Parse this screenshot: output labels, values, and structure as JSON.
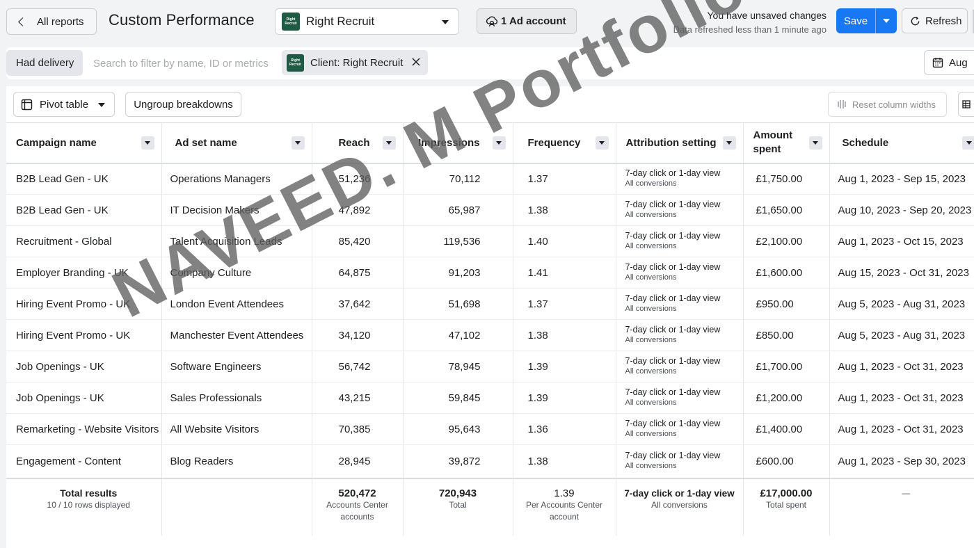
{
  "header": {
    "back_label": "All reports",
    "title": "Custom Performance",
    "client_select_value": "Right Recruit",
    "client_logo_text": "Right Recruit",
    "ad_account_label": "1 Ad account",
    "unsaved_text": "You have unsaved changes",
    "refreshed_text": "Data refreshed less than 1 minute ago",
    "save_label": "Save",
    "refresh_label": "Refresh"
  },
  "filters": {
    "had_delivery_label": "Had delivery",
    "search_placeholder": "Search to filter by name, ID or metrics",
    "client_chip_label": "Client: Right Recruit",
    "date_label": "Aug"
  },
  "toolbar": {
    "pivot_label": "Pivot table",
    "ungroup_label": "Ungroup breakdowns",
    "reset_label": "Reset column widths"
  },
  "columns": {
    "campaign": "Campaign name",
    "adset": "Ad set name",
    "reach": "Reach",
    "impressions": "Impressions",
    "frequency": "Frequency",
    "attribution": "Attribution setting",
    "amount": "Amount spent",
    "schedule": "Schedule"
  },
  "rows": [
    {
      "campaign": "B2B Lead Gen - UK",
      "adset": "Operations Managers",
      "reach": "51,236",
      "impressions": "70,112",
      "frequency": "1.37",
      "attr1": "7-day click or 1-day view",
      "attr2": "All conversions",
      "amount": "£1,750.00",
      "schedule": "Aug 1, 2023 - Sep 15, 2023"
    },
    {
      "campaign": "B2B Lead Gen - UK",
      "adset": "IT Decision Makers",
      "reach": "47,892",
      "impressions": "65,987",
      "frequency": "1.38",
      "attr1": "7-day click or 1-day view",
      "attr2": "All conversions",
      "amount": "£1,650.00",
      "schedule": "Aug 10, 2023 - Sep 20, 2023"
    },
    {
      "campaign": "Recruitment - Global",
      "adset": "Talent Acquisition Leads",
      "reach": "85,420",
      "impressions": "119,536",
      "frequency": "1.40",
      "attr1": "7-day click or 1-day view",
      "attr2": "All conversions",
      "amount": "£2,100.00",
      "schedule": "Aug 1, 2023 - Oct 15, 2023"
    },
    {
      "campaign": "Employer Branding - UK",
      "adset": "Company Culture",
      "reach": "64,875",
      "impressions": "91,203",
      "frequency": "1.41",
      "attr1": "7-day click or 1-day view",
      "attr2": "All conversions",
      "amount": "£1,600.00",
      "schedule": "Aug 15, 2023 - Oct 31, 2023"
    },
    {
      "campaign": "Hiring Event Promo - UK",
      "adset": "London Event Attendees",
      "reach": "37,642",
      "impressions": "51,698",
      "frequency": "1.37",
      "attr1": "7-day click or 1-day view",
      "attr2": "All conversions",
      "amount": "£950.00",
      "schedule": "Aug 5, 2023 - Aug 31, 2023"
    },
    {
      "campaign": "Hiring Event Promo - UK",
      "adset": "Manchester Event Attendees",
      "reach": "34,120",
      "impressions": "47,102",
      "frequency": "1.38",
      "attr1": "7-day click or 1-day view",
      "attr2": "All conversions",
      "amount": "£850.00",
      "schedule": "Aug 5, 2023 - Aug 31, 2023"
    },
    {
      "campaign": "Job Openings - UK",
      "adset": "Software Engineers",
      "reach": "56,742",
      "impressions": "78,945",
      "frequency": "1.39",
      "attr1": "7-day click or 1-day view",
      "attr2": "All conversions",
      "amount": "£1,700.00",
      "schedule": "Aug 1, 2023 - Oct 31, 2023"
    },
    {
      "campaign": "Job Openings - UK",
      "adset": "Sales Professionals",
      "reach": "43,215",
      "impressions": "59,845",
      "frequency": "1.39",
      "attr1": "7-day click or 1-day view",
      "attr2": "All conversions",
      "amount": "£1,200.00",
      "schedule": "Aug 1, 2023 - Oct 31, 2023"
    },
    {
      "campaign": "Remarketing - Website Visitors",
      "adset": "All Website Visitors",
      "reach": "70,385",
      "impressions": "95,643",
      "frequency": "1.36",
      "attr1": "7-day click or 1-day view",
      "attr2": "All conversions",
      "amount": "£1,400.00",
      "schedule": "Aug 1, 2023 - Oct 31, 2023"
    },
    {
      "campaign": "Engagement - Content",
      "adset": "Blog Readers",
      "reach": "28,945",
      "impressions": "39,872",
      "frequency": "1.38",
      "attr1": "7-day click or 1-day view",
      "attr2": "All conversions",
      "amount": "£600.00",
      "schedule": "Aug 1, 2023 - Sep 30, 2023"
    }
  ],
  "totals": {
    "label": "Total results",
    "rows_displayed": "10 / 10 rows displayed",
    "reach": "520,472",
    "reach_sub": "Accounts Center accounts",
    "impressions": "720,943",
    "impressions_sub": "Total",
    "frequency": "1.39",
    "frequency_sub": "Per Accounts Center account",
    "attribution": "7-day click or 1-day view",
    "attribution_sub": "All conversions",
    "amount": "£17,000.00",
    "amount_sub": "Total spent",
    "schedule": "—"
  },
  "watermark": "NAVEED. M Portfolio",
  "colors": {
    "primary": "#1877f2",
    "brand_logo": "#1f5a44",
    "background": "#f2f3f5"
  }
}
